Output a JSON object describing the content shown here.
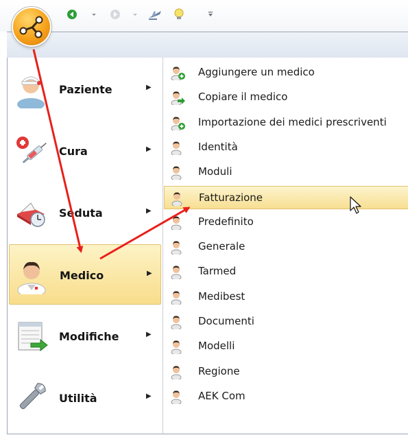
{
  "quick_access": {
    "icons": [
      "back-icon",
      "dropdown-icon",
      "forward-icon",
      "dropdown-icon",
      "airplane-icon",
      "lightbulb-icon",
      "customize-icon"
    ]
  },
  "menu": {
    "left_items": [
      {
        "label": "Paziente",
        "icon": "patient-icon"
      },
      {
        "label": "Cura",
        "icon": "syringe-icon"
      },
      {
        "label": "Seduta",
        "icon": "session-icon"
      },
      {
        "label": "Medico",
        "icon": "doctor-icon"
      },
      {
        "label": "Modifiche",
        "icon": "changes-icon"
      },
      {
        "label": "Utilità",
        "icon": "wrench-icon"
      }
    ],
    "active_left": "Medico",
    "submenu_items": [
      {
        "label": "Aggiungere un medico",
        "icon": "doctor-add-icon"
      },
      {
        "label": "Copiare il medico",
        "icon": "doctor-copy-icon"
      },
      {
        "label": "Importazione dei medici prescriventi",
        "icon": "doctor-add-icon"
      },
      {
        "label": "Identità",
        "icon": "doctor-icon"
      },
      {
        "label": "Moduli",
        "icon": "doctor-icon"
      },
      {
        "label": "Fatturazione",
        "icon": "doctor-icon"
      },
      {
        "label": "Predefinito",
        "icon": "doctor-icon"
      },
      {
        "label": "Generale",
        "icon": "doctor-icon"
      },
      {
        "label": "Tarmed",
        "icon": "doctor-icon"
      },
      {
        "label": "Medibest",
        "icon": "doctor-icon"
      },
      {
        "label": "Documenti",
        "icon": "doctor-icon"
      },
      {
        "label": "Modelli",
        "icon": "doctor-icon"
      },
      {
        "label": "Regione",
        "icon": "doctor-icon"
      },
      {
        "label": "AEK Com",
        "icon": "doctor-icon"
      }
    ],
    "active_submenu": "Fatturazione"
  },
  "colors": {
    "highlight": "#f8dd8b",
    "annotation_arrow": "#e8201a"
  }
}
